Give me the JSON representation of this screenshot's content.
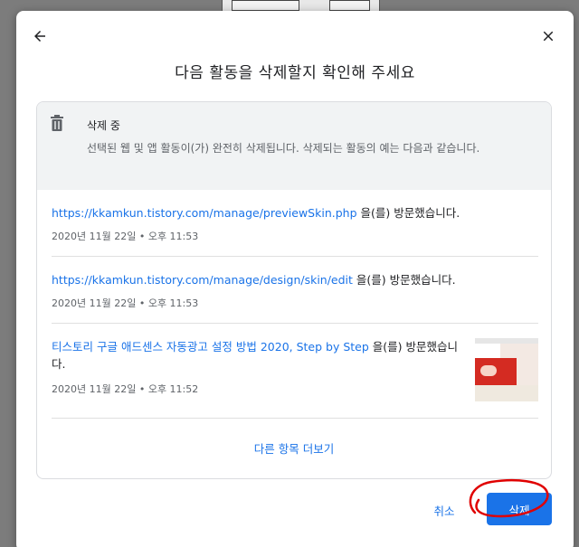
{
  "dialog": {
    "title": "다음 활동을 삭제할지 확인해 주세요",
    "back_icon": "arrow-left-icon",
    "close_icon": "close-icon"
  },
  "notice": {
    "icon": "trash-icon",
    "heading": "삭제 중",
    "body": "선택된 웹 및 앱 활동이(가) 완전히 삭제됩니다. 삭제되는 활동의 예는 다음과 같습니다."
  },
  "activities": [
    {
      "link": "https://kkamkun.tistory.com/manage/previewSkin.php",
      "suffix": " 을(를) 방문했습니다.",
      "time": "2020년 11월 22일 • 오후 11:53"
    },
    {
      "link": "https://kkamkun.tistory.com/manage/design/skin/edit",
      "suffix": " 을(를) 방문했습니다.",
      "time": "2020년 11월 22일 • 오후 11:53"
    },
    {
      "link": "티스토리 구글 애드센스 자동광고 설정 방법 2020, Step by Step",
      "suffix": " 을(를) 방문했습니다.",
      "time": "2020년 11월 22일 • 오후 11:52"
    }
  ],
  "more_label": "다른 항목 더보기",
  "buttons": {
    "cancel": "취소",
    "delete": "삭제"
  },
  "colors": {
    "accent": "#1a73e8",
    "annotation": "#e00000"
  }
}
